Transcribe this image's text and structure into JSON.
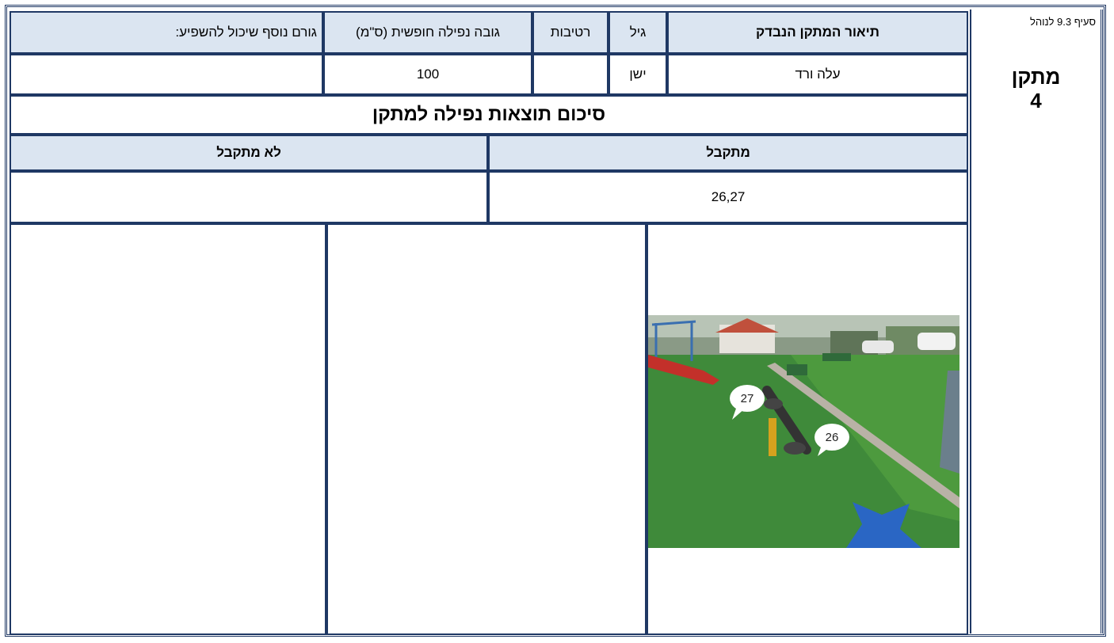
{
  "sidebar": {
    "clause": "סעיף 9.3 לנוהל",
    "fixture_title": "מתקן",
    "fixture_number": "4"
  },
  "table": {
    "headers": {
      "description": "תיאור המתקן הנבדק",
      "age": "גיל",
      "moisture": "רטיבות",
      "fall_height": "גובה נפילה חופשית (ס\"מ)",
      "other_factor": "גורם נוסף שיכול להשפיע:"
    },
    "values": {
      "description": "עלה ורד",
      "age": "ישן",
      "moisture": "",
      "fall_height": "100",
      "other_factor": ""
    }
  },
  "summary": {
    "title": "סיכום תוצאות נפילה למתקן",
    "accepted_label": "מתקבל",
    "rejected_label": "לא מתקבל",
    "accepted_value": "26,27",
    "rejected_value": ""
  },
  "photo": {
    "markers": [
      "27",
      "26"
    ]
  },
  "colors": {
    "border": "#1f3864",
    "header_fill": "#dbe5f1"
  }
}
